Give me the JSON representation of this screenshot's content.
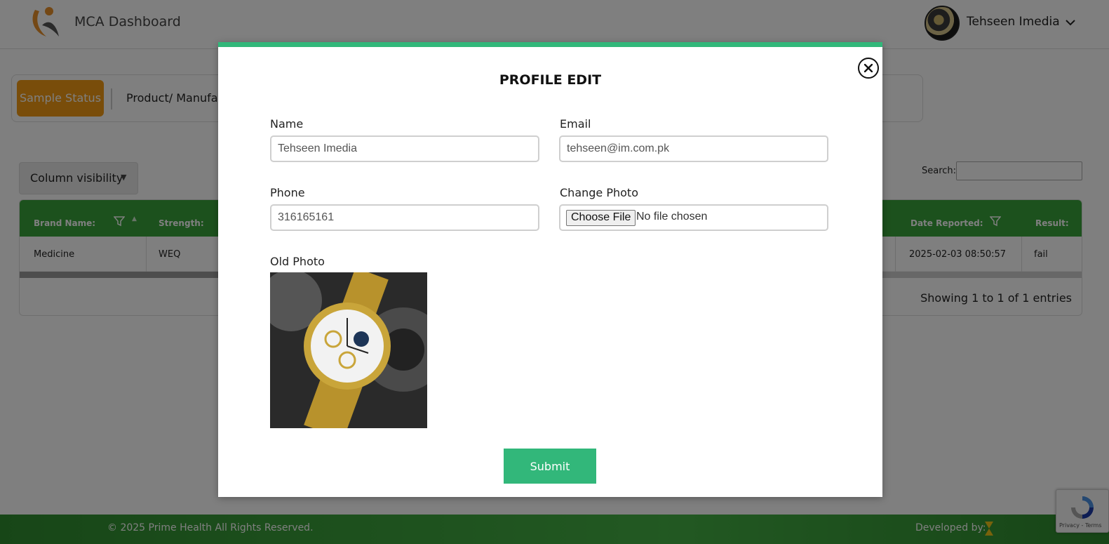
{
  "header": {
    "app_title": "MCA Dashboard",
    "user_name": "Tehseen Imedia"
  },
  "tabs": {
    "active_label": "Sample Status",
    "second_label": "Product/ Manufact"
  },
  "table_controls": {
    "column_visibility_label": "Column visibility",
    "search_label": "Search:"
  },
  "table": {
    "columns": [
      "Brand Name:",
      "Strength:",
      "Date Reported:",
      "Result:"
    ],
    "rows": [
      {
        "brand": "Medicine",
        "strength": "WEQ",
        "date_reported": "2025-02-03 08:50:57",
        "result": "fail"
      }
    ],
    "info": "Showing 1 to 1 of 1 entries"
  },
  "footer": {
    "copyright": "© 2025 Prime Health All Rights Reserved.",
    "developed_by": "Developed by:"
  },
  "recaptcha": {
    "text": "Privacy - Terms"
  },
  "modal": {
    "title": "PROFILE EDIT",
    "name_label": "Name",
    "name_value": "Tehseen Imedia",
    "email_label": "Email",
    "email_value": "tehseen@im.com.pk",
    "phone_label": "Phone",
    "phone_value": "316165161",
    "photo_label": "Change Photo",
    "file_button_label": "Choose File",
    "file_status": "No file chosen",
    "old_photo_label": "Old Photo",
    "submit_label": "Submit"
  },
  "colors": {
    "accent_green": "#32b77a",
    "table_header_green": "#38a33a",
    "tab_orange": "#f29b14"
  }
}
